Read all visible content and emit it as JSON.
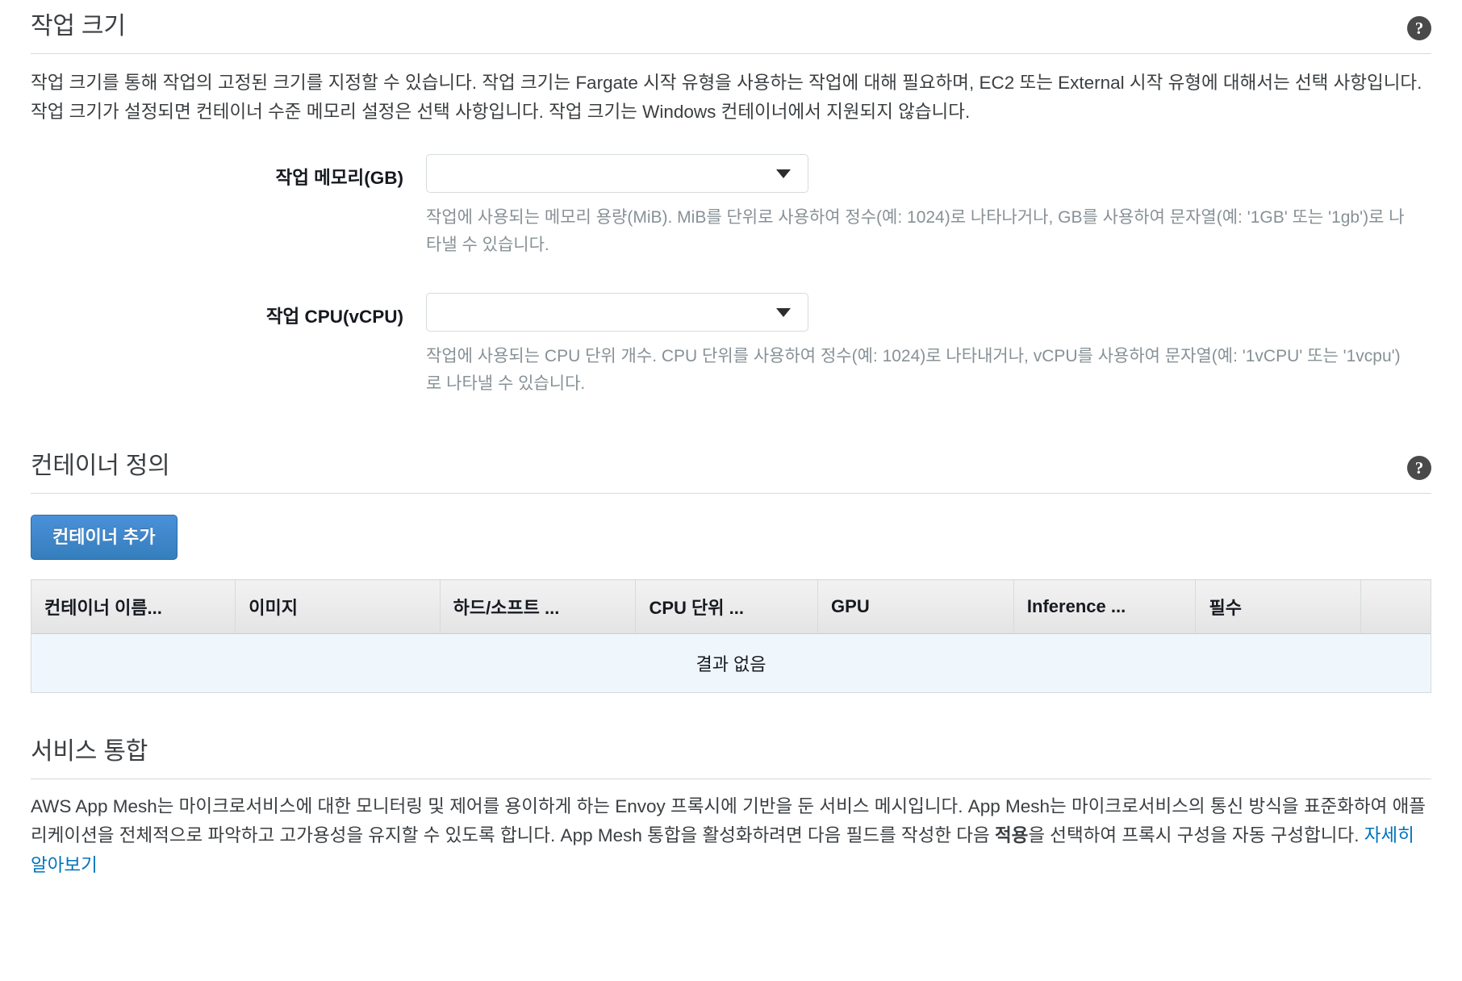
{
  "task_size": {
    "title": "작업 크기",
    "help_icon": "question-mark-icon",
    "description": "작업 크기를 통해 작업의 고정된 크기를 지정할 수 있습니다. 작업 크기는 Fargate 시작 유형을 사용하는 작업에 대해 필요하며, EC2 또는 External 시작 유형에 대해서는 선택 사항입니다. 작업 크기가 설정되면 컨테이너 수준 메모리 설정은 선택 사항입니다. 작업 크기는 Windows 컨테이너에서 지원되지 않습니다.",
    "memory": {
      "label": "작업 메모리(GB)",
      "value": "",
      "placeholder": "",
      "options": [
        ""
      ],
      "help": "작업에 사용되는 메모리 용량(MiB). MiB를 단위로 사용하여 정수(예: 1024)로 나타나거나, GB를 사용하여 문자열(예: '1GB' 또는 '1gb')로 나타낼 수 있습니다."
    },
    "cpu": {
      "label": "작업 CPU(vCPU)",
      "value": "",
      "placeholder": "",
      "options": [
        ""
      ],
      "help": "작업에 사용되는 CPU 단위 개수. CPU 단위를 사용하여 정수(예: 1024)로 나타내거나, vCPU를 사용하여 문자열(예: '1vCPU' 또는 '1vcpu')로 나타낼 수 있습니다."
    }
  },
  "container_definitions": {
    "title": "컨테이너 정의",
    "help_icon": "question-mark-icon",
    "add_button": "컨테이너 추가",
    "columns": [
      "컨테이너 이름...",
      "이미지",
      "하드/소프트 ...",
      "CPU 단위 ...",
      "GPU",
      "Inference ...",
      "필수",
      ""
    ],
    "empty_message": "결과 없음",
    "rows": []
  },
  "service_integration": {
    "title": "서비스 통합",
    "description_part1": "AWS App Mesh는 마이크로서비스에 대한 모니터링 및 제어를 용이하게 하는 Envoy 프록시에 기반을 둔 서비스 메시입니다. App Mesh는 마이크로서비스의 통신 방식을 표준화하여 애플리케이션을 전체적으로 파악하고 고가용성을 유지할 수 있도록 합니다. App Mesh 통합을 활성화하려면 다음 필드를 작성한 다음 ",
    "bold_word": "적용",
    "description_part2": "을 선택하여 프록시 구성을 자동 구성합니다. ",
    "link_text": "자세히 알아보기"
  },
  "colors": {
    "accent": "#0073bb",
    "button": "#357ebd",
    "help_icon_bg": "#4a4a4a",
    "empty_row_bg": "#eff7fd",
    "muted_text": "#879196"
  }
}
